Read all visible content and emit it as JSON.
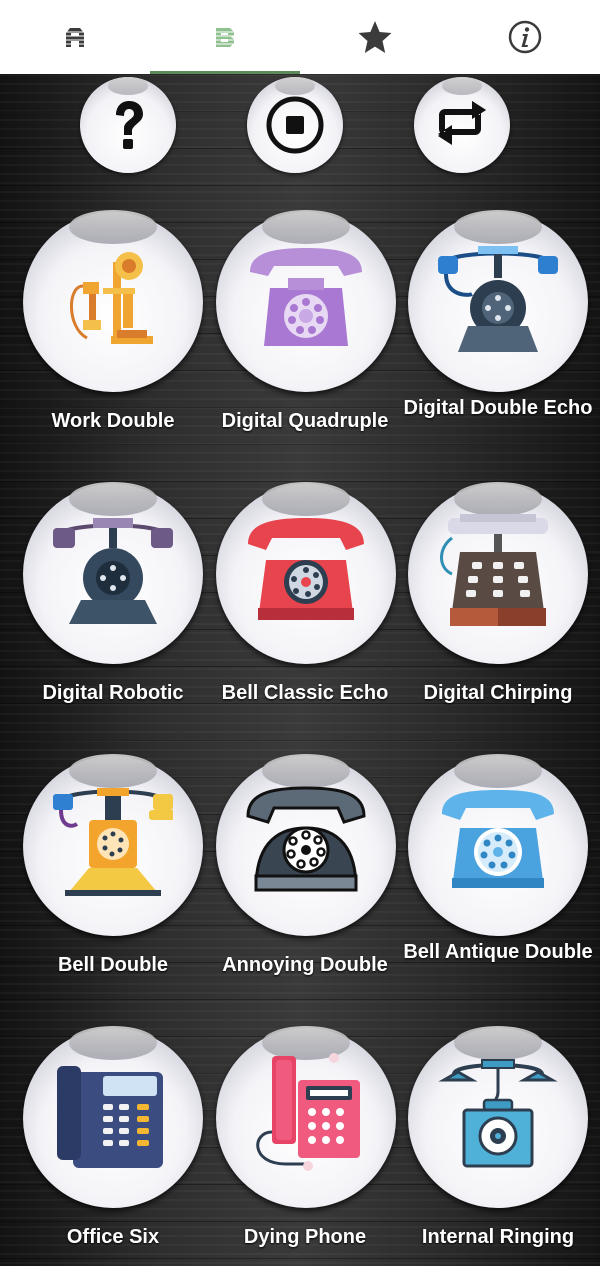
{
  "tabs": [
    {
      "icon": "alphabet-a-icon",
      "active": false
    },
    {
      "icon": "alphabet-b-icon",
      "active": true
    },
    {
      "icon": "star-icon",
      "active": false
    },
    {
      "icon": "info-icon",
      "active": false
    }
  ],
  "controls": [
    {
      "icon": "question-icon"
    },
    {
      "icon": "stop-icon"
    },
    {
      "icon": "repeat-icon"
    }
  ],
  "sounds": [
    {
      "label": "Work Double"
    },
    {
      "label": "Digital Quadruple"
    },
    {
      "label": "Digital Double Echo"
    },
    {
      "label": "Digital Robotic"
    },
    {
      "label": "Bell Classic Echo"
    },
    {
      "label": "Digital Chirping"
    },
    {
      "label": "Bell Double"
    },
    {
      "label": "Annoying Double"
    },
    {
      "label": "Bell Antique Double"
    },
    {
      "label": "Office Six"
    },
    {
      "label": "Dying Phone"
    },
    {
      "label": "Internal Ringing"
    }
  ],
  "colors": {
    "active_tab_indicator": "#5b8a5b",
    "tab_bar": "#ffffff"
  }
}
